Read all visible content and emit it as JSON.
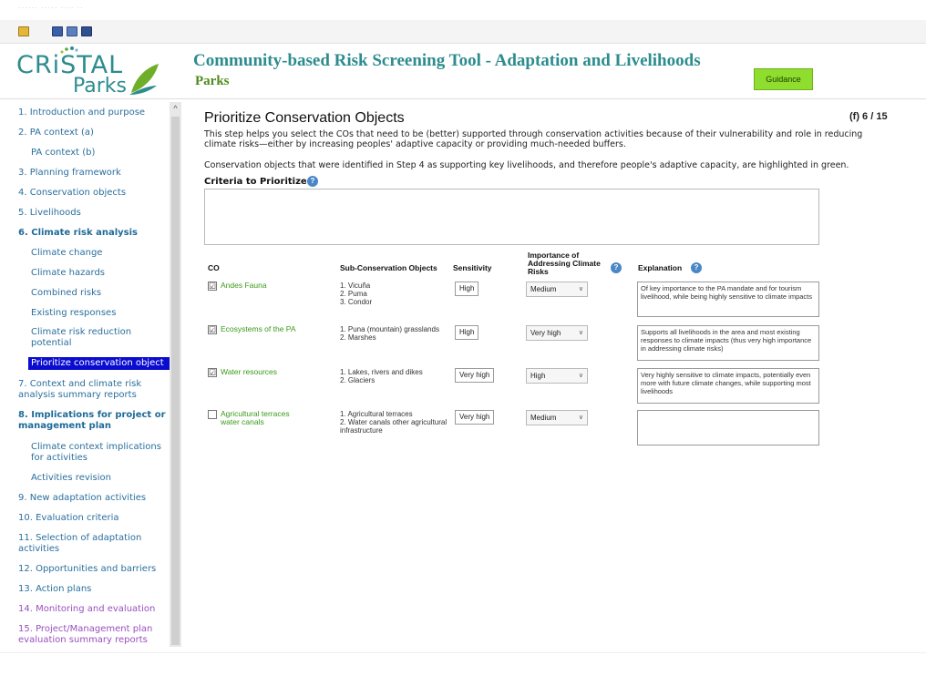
{
  "topbar": {
    "faint_text": "······ ····· ···· ··"
  },
  "toolbar": {
    "icons": [
      "folder-open-icon",
      "save-icon",
      "edit-icon",
      "disk-icon"
    ]
  },
  "header": {
    "logo_cristal": "CRiSTAL",
    "logo_parks": "Parks",
    "title": "Community-based Risk Screening Tool - Adaptation and Livelihoods",
    "subtitle": "Parks",
    "guidance_label": "Guidance"
  },
  "colors": {
    "brand_teal": "#2c8c8e",
    "brand_green": "#4f8a1a",
    "guidance_green": "#8fdd2f",
    "nav_active_bg": "#0a0ccf",
    "link_blue": "#2a6f9e",
    "link_purple": "#9a4fc0",
    "co_green": "#3a9a1a"
  },
  "sidebar": {
    "items": [
      {
        "label": "1. Introduction and purpose"
      },
      {
        "label": "2. PA context (a)"
      },
      {
        "label": "PA context (b)"
      },
      {
        "label": "3. Planning framework"
      },
      {
        "label": "4. Conservation objects"
      },
      {
        "label": "5. Livelihoods"
      },
      {
        "label": "6. Climate risk analysis"
      },
      {
        "label": "Climate change"
      },
      {
        "label": "Climate hazards"
      },
      {
        "label": "Combined risks"
      },
      {
        "label": "Existing responses"
      },
      {
        "label": "Climate risk reduction potential"
      },
      {
        "label": "Prioritize conservation object"
      },
      {
        "label": "7. Context and climate risk analysis summary reports"
      },
      {
        "label": "8. Implications for project or management plan"
      },
      {
        "label": "Climate context implications for activities"
      },
      {
        "label": "Activities revision"
      },
      {
        "label": "9. New adaptation activities"
      },
      {
        "label": "10. Evaluation criteria"
      },
      {
        "label": "11. Selection of adaptation activities"
      },
      {
        "label": "12. Opportunities and barriers"
      },
      {
        "label": "13. Action plans"
      },
      {
        "label": "14. Monitoring and evaluation"
      },
      {
        "label": "15. Project/Management plan evaluation summary reports"
      }
    ]
  },
  "main": {
    "title": "Prioritize Conservation Objects",
    "counter": "(f) 6 / 15",
    "intro": "This step helps you select the COs that need to be (better) supported through conservation activities because of their vulnerability and role in reducing climate risks—either by increasing peoples' adaptive capacity or providing much-needed buffers.",
    "intro2": "Conservation objects that were identified in Step 4 as supporting key livelihoods, and therefore people's adaptive capacity, are highlighted in green.",
    "criteria_label": "Criteria to Prioritize",
    "criteria_value": "",
    "info_icon_glyph": "?",
    "columns": {
      "co": "CO",
      "sub": "Sub-Conservation Objects",
      "sensitivity": "Sensitivity",
      "importance": "Importance of Addressing Climate Risks",
      "explanation": "Explanation"
    },
    "rows": [
      {
        "checked": "☑",
        "co": "Andes Fauna",
        "sub": "1. Vicuña\n2. Puma\n3. Condor",
        "sensitivity": "High",
        "importance": "Medium",
        "explanation": "Of key importance to the PA mandate and for tourism livelihood, while being highly sensitive to climate impacts"
      },
      {
        "checked": "☑",
        "co": "Ecosystems of the PA",
        "sub": "1. Puna (mountain) grasslands\n2. Marshes",
        "sensitivity": "High",
        "importance": "Very high",
        "explanation": "Supports all livelihoods in the area and most existing responses to climate impacts (thus very high importance in addressing climate risks)"
      },
      {
        "checked": "☑",
        "co": "Water resources",
        "sub": "1. Lakes, rivers and dikes\n2. Glaciers",
        "sensitivity": "Very high",
        "importance": "High",
        "explanation": "Very highly sensitive to climate impacts, potentially even more with future climate changes, while supporting most livelihoods"
      },
      {
        "checked": "",
        "co": "Agricultural terraces water canals",
        "sub": "1. Agricultural terraces\n2. Water canals  other agricultural infrastructure",
        "sensitivity": "Very high",
        "importance": "Medium",
        "explanation": ""
      }
    ]
  }
}
